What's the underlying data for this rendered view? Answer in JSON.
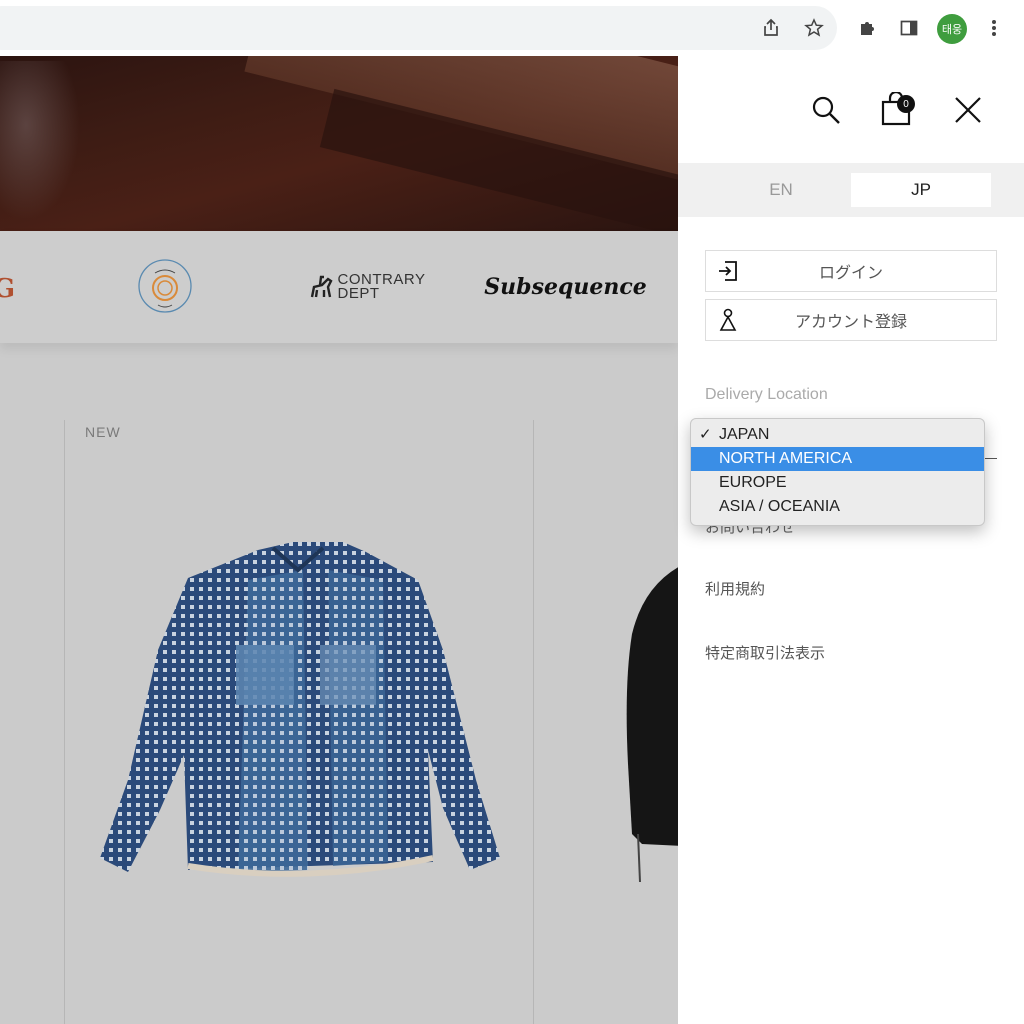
{
  "browser": {
    "icons": [
      "share-icon",
      "bookmark-star-icon",
      "extensions-icon",
      "side-panel-icon",
      "menu-icon"
    ],
    "profile_initials": "태웅",
    "profile_color": "#3f9d3e"
  },
  "page": {
    "new_label": "NEW",
    "brands": {
      "cutoff": "G",
      "contrary_line1": "CONTRARY",
      "contrary_line2": "DEPT",
      "subsequence": "Subsequence"
    }
  },
  "panel": {
    "cart_count": "0",
    "languages": [
      {
        "label": "EN",
        "active": false
      },
      {
        "label": "JP",
        "active": true
      }
    ],
    "login_label": "ログイン",
    "register_label": "アカウント登録",
    "delivery_label": "Delivery Location",
    "partially_hidden_link": "お問い合わせ",
    "links": [
      "利用規約",
      "特定商取引法表示"
    ]
  },
  "dropdown": {
    "options": [
      "JAPAN",
      "NORTH AMERICA",
      "EUROPE",
      "ASIA / OCEANIA"
    ],
    "selected": "JAPAN",
    "highlighted": "NORTH AMERICA",
    "highlight_color": "#3a8ee6"
  }
}
